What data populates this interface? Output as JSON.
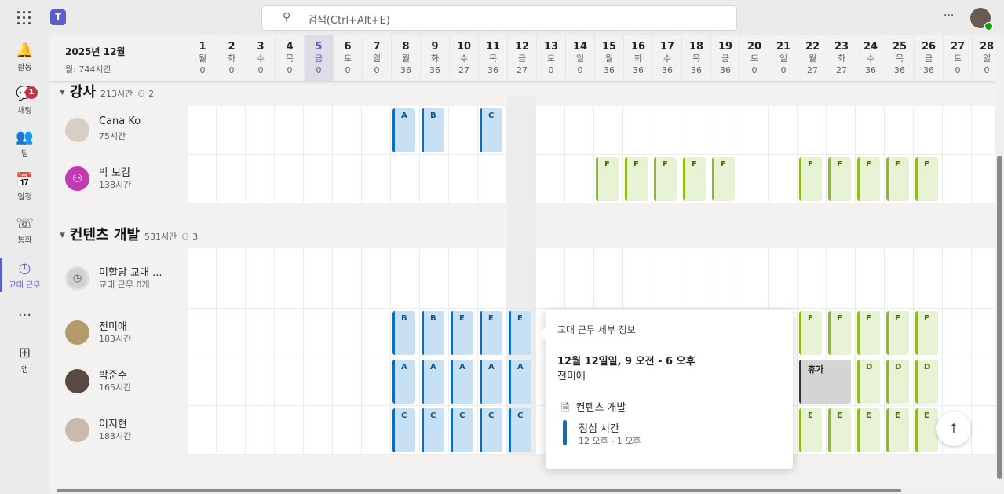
{
  "app": {
    "search_placeholder": "검색(Ctrl+Alt+E)",
    "more": "···",
    "logo": "T"
  },
  "rail": [
    {
      "label": "활동",
      "icon": "bell-icon",
      "g": "🔔"
    },
    {
      "label": "채팅",
      "icon": "chat-icon",
      "g": "💬",
      "badge": "1"
    },
    {
      "label": "팀",
      "icon": "teams-icon",
      "g": "👥"
    },
    {
      "label": "일정",
      "icon": "calendar-icon",
      "g": "📅"
    },
    {
      "label": "통화",
      "icon": "phone-icon",
      "g": "☏"
    },
    {
      "label": "교대 근무",
      "icon": "shifts-icon",
      "g": "◷",
      "selected": true
    },
    {
      "label": "",
      "icon": "more-icon",
      "g": "···"
    },
    {
      "label": "앱",
      "icon": "add-app-icon",
      "g": "⊞"
    }
  ],
  "header": {
    "month": "2025년 12월",
    "hours": "월: 744시간",
    "today": 5,
    "days": [
      [
        "1",
        "월",
        "0"
      ],
      [
        "2",
        "화",
        "0"
      ],
      [
        "3",
        "수",
        "0"
      ],
      [
        "4",
        "목",
        "0"
      ],
      [
        "5",
        "금",
        "0"
      ],
      [
        "6",
        "토",
        "0"
      ],
      [
        "7",
        "일",
        "0"
      ],
      [
        "8",
        "월",
        "36"
      ],
      [
        "9",
        "화",
        "36"
      ],
      [
        "10",
        "수",
        "27"
      ],
      [
        "11",
        "목",
        "36"
      ],
      [
        "12",
        "금",
        "27"
      ],
      [
        "13",
        "토",
        "0"
      ],
      [
        "14",
        "일",
        "0"
      ],
      [
        "15",
        "월",
        "36"
      ],
      [
        "16",
        "화",
        "36"
      ],
      [
        "17",
        "수",
        "36"
      ],
      [
        "18",
        "목",
        "36"
      ],
      [
        "19",
        "금",
        "36"
      ],
      [
        "20",
        "토",
        "0"
      ],
      [
        "21",
        "일",
        "0"
      ],
      [
        "22",
        "월",
        "27"
      ],
      [
        "23",
        "화",
        "27"
      ],
      [
        "24",
        "수",
        "36"
      ],
      [
        "25",
        "목",
        "36"
      ],
      [
        "26",
        "금",
        "36"
      ],
      [
        "27",
        "토",
        "0"
      ],
      [
        "28",
        "일",
        "0"
      ]
    ]
  },
  "highlight_day": 12,
  "groups": [
    {
      "name": "강사",
      "hours": "213시간",
      "members": "2",
      "members_icon": "people-icon",
      "people": [
        {
          "name": "Cana Ko",
          "hours": "75시간",
          "avatar": "#d8cfc4",
          "shifts": [
            [
              8,
              1,
              "A",
              "blue"
            ],
            [
              9,
              1,
              "B",
              "blue"
            ],
            [
              11,
              1,
              "C",
              "blue"
            ]
          ]
        },
        {
          "name": "박 보검",
          "hours": "138시간",
          "avatar": "#c239b3",
          "shifts": [
            [
              15,
              1,
              "F",
              "green"
            ],
            [
              16,
              1,
              "F",
              "green"
            ],
            [
              17,
              1,
              "F",
              "green"
            ],
            [
              18,
              1,
              "F",
              "green"
            ],
            [
              19,
              1,
              "F",
              "green"
            ],
            [
              22,
              1,
              "F",
              "green"
            ],
            [
              23,
              1,
              "F",
              "green"
            ],
            [
              24,
              1,
              "F",
              "green"
            ],
            [
              25,
              1,
              "F",
              "green"
            ],
            [
              26,
              1,
              "F",
              "green"
            ]
          ]
        }
      ]
    },
    {
      "name": "컨텐츠 개발",
      "hours": "531시간",
      "members": "3",
      "members_icon": "people-icon",
      "people": [
        {
          "name": "미할당 교대 ...",
          "hours": "교대 근무 0개",
          "avatar": "#d1d1d1",
          "shifts": []
        },
        {
          "name": "전미애",
          "hours": "183시간",
          "avatar": "#b49a6a",
          "shifts": [
            [
              8,
              1,
              "B",
              "blue"
            ],
            [
              9,
              1,
              "B",
              "blue"
            ],
            [
              10,
              1,
              "E",
              "blue"
            ],
            [
              11,
              1,
              "E",
              "blue"
            ],
            [
              12,
              1,
              "E",
              "blue"
            ],
            [
              22,
              1,
              "F",
              "green"
            ],
            [
              23,
              1,
              "F",
              "green"
            ],
            [
              24,
              1,
              "F",
              "green"
            ],
            [
              25,
              1,
              "F",
              "green"
            ],
            [
              26,
              1,
              "F",
              "green"
            ]
          ]
        },
        {
          "name": "박준수",
          "hours": "165시간",
          "avatar": "#5a4a44",
          "shifts": [
            [
              8,
              1,
              "A",
              "blue"
            ],
            [
              9,
              1,
              "A",
              "blue"
            ],
            [
              10,
              1,
              "A",
              "blue"
            ],
            [
              11,
              1,
              "A",
              "blue"
            ],
            [
              12,
              1,
              "A",
              "blue"
            ],
            [
              22,
              2,
              "휴가",
              "gray"
            ],
            [
              24,
              1,
              "D",
              "green"
            ],
            [
              25,
              1,
              "D",
              "green"
            ],
            [
              26,
              1,
              "D",
              "green"
            ]
          ]
        },
        {
          "name": "이지현",
          "hours": "183시간",
          "avatar": "#c9b9ae",
          "shifts": [
            [
              8,
              1,
              "C",
              "blue"
            ],
            [
              9,
              1,
              "C",
              "blue"
            ],
            [
              10,
              1,
              "C",
              "blue"
            ],
            [
              11,
              1,
              "C",
              "blue"
            ],
            [
              12,
              1,
              "C",
              "blue"
            ],
            [
              22,
              1,
              "E",
              "green"
            ],
            [
              23,
              1,
              "E",
              "green"
            ],
            [
              24,
              1,
              "E",
              "green"
            ],
            [
              25,
              1,
              "E",
              "green"
            ],
            [
              26,
              1,
              "E",
              "green"
            ]
          ]
        }
      ]
    }
  ],
  "popup": {
    "title": "교대 근무 세부 정보",
    "datetime": "12월 12일일, 9 오전 - 6 오후",
    "person": "전미애",
    "group": "컨텐츠 개발",
    "activity": "점심 시간",
    "activity_time": "12 오후 - 1 오후",
    "activity_color": "#0f6cbd"
  },
  "scroll_top": "↑"
}
